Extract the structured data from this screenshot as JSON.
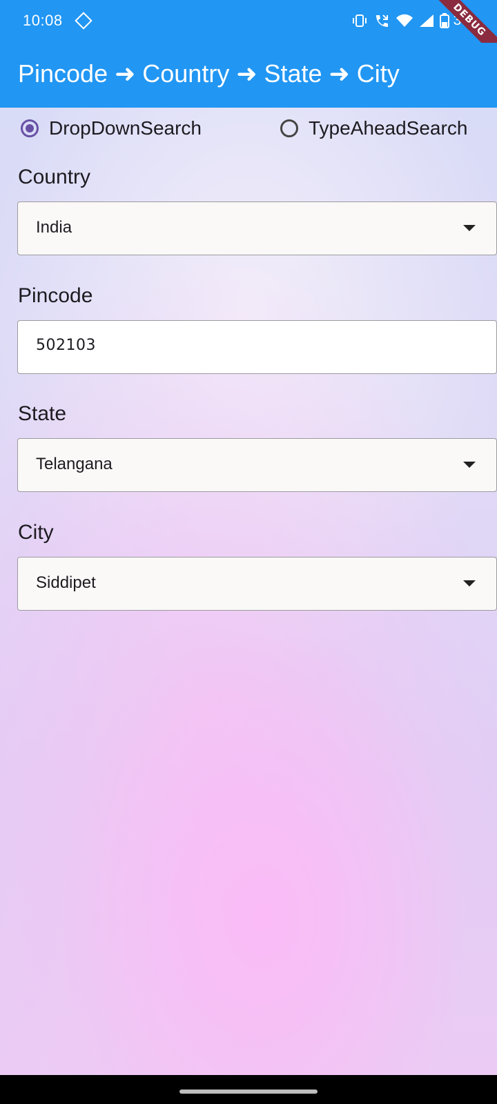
{
  "status_bar": {
    "time": "10:08",
    "battery_text": "38",
    "debug_label": "DEBUG"
  },
  "app_bar": {
    "title": "Pincode ➜ Country ➜ State ➜ City",
    "color": "#2196f3"
  },
  "search_mode": {
    "options": [
      {
        "label": "DropDownSearch",
        "selected": true
      },
      {
        "label": "TypeAheadSearch",
        "selected": false
      }
    ]
  },
  "form": {
    "country": {
      "label": "Country",
      "value": "India"
    },
    "pincode": {
      "label": "Pincode",
      "value": "502103"
    },
    "state": {
      "label": "State",
      "value": "Telangana"
    },
    "city": {
      "label": "City",
      "value": "Siddipet"
    }
  },
  "icons": {
    "dropdown": "caret-down-icon",
    "radio_selected": "radio-checked-icon",
    "radio_unselected": "radio-unchecked-icon"
  },
  "accent_color": "#6750a4"
}
